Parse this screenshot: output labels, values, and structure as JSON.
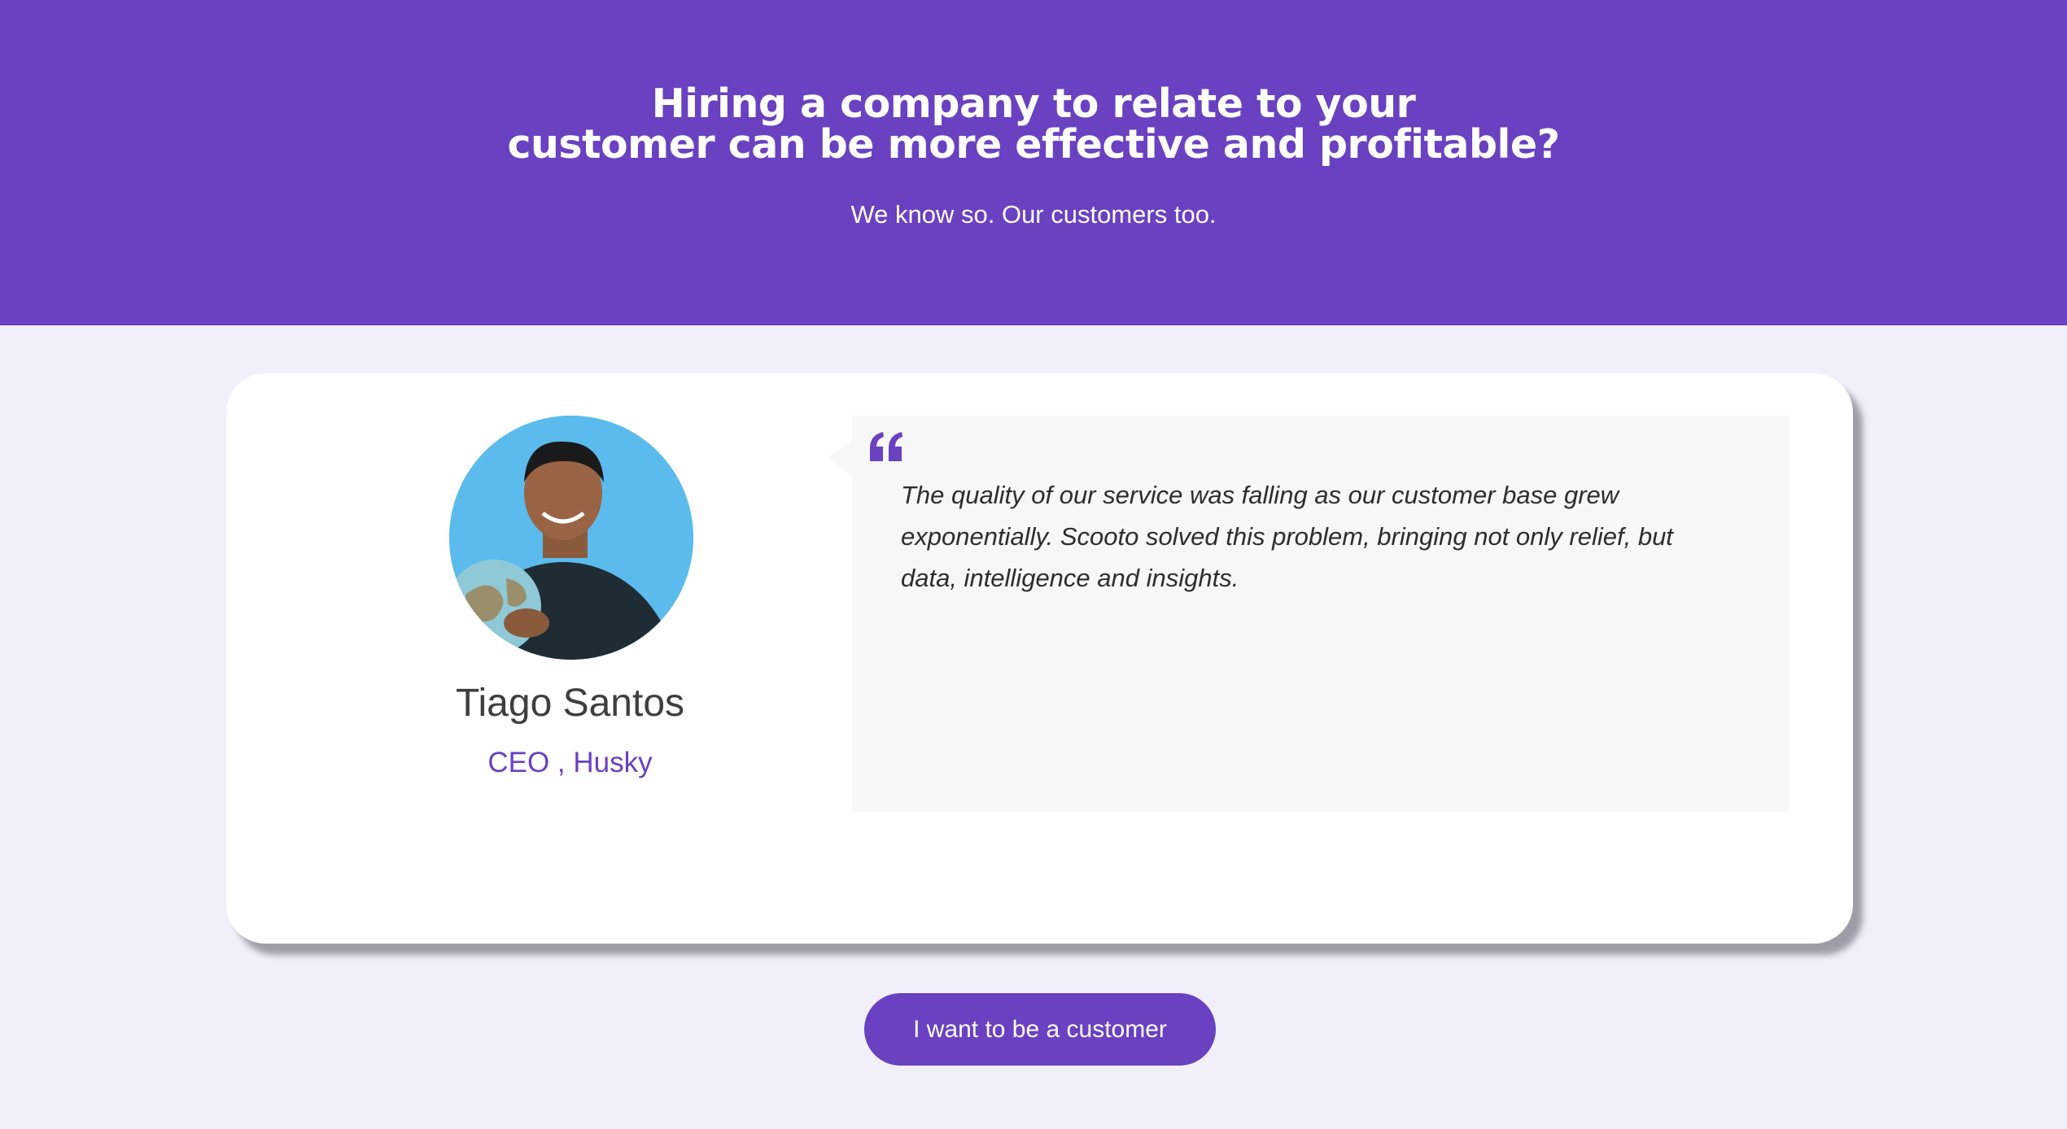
{
  "hero": {
    "title_line1": "Hiring a company to relate to your",
    "title_line2": "customer can be more effective and profitable?",
    "subtitle": "We know so. Our customers too.",
    "background_color": "#6941c1"
  },
  "testimonial": {
    "person_name": "Tiago Santos",
    "person_role": "CEO , Husky",
    "quote_icon": "quote-icon",
    "quote": "The quality of our service was falling as our customer base grew exponentially. Scooto solved this problem, bringing not only relief, but data, intelligence and insights."
  },
  "cta": {
    "label": "I want to be a customer"
  },
  "colors": {
    "accent": "#6941c1",
    "page_background": "#f1eff9",
    "quote_background": "#f7f7f7"
  }
}
